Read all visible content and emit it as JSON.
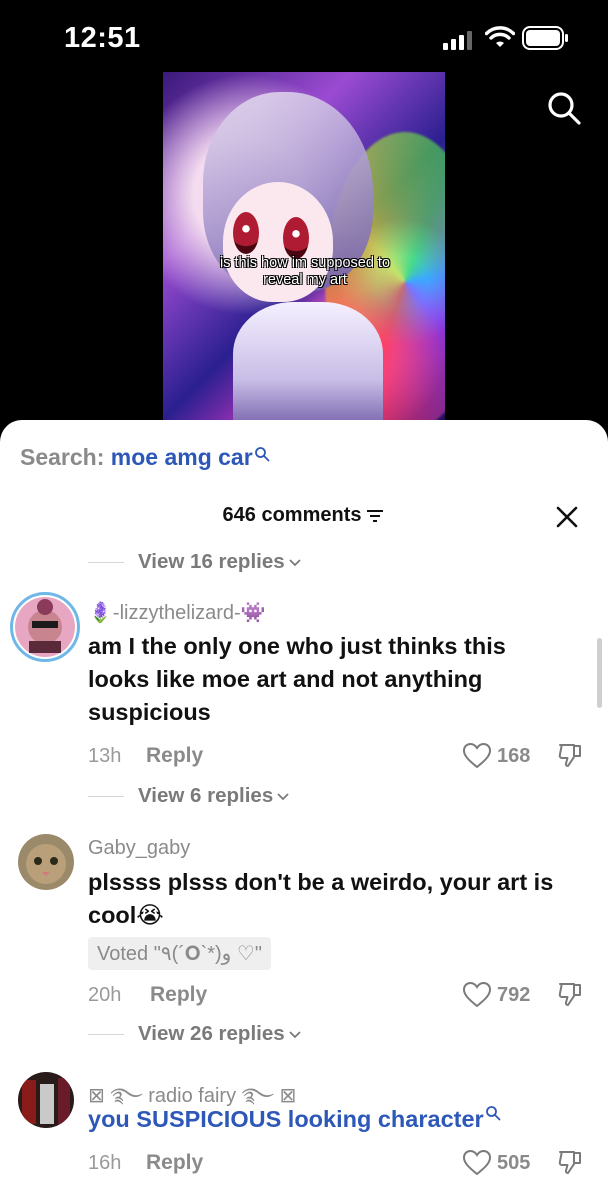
{
  "status_bar": {
    "time": "12:51"
  },
  "video": {
    "caption": "is this how im supposed to reveal my art"
  },
  "sheet": {
    "search_prefix": "Search:",
    "search_term": "moe amg car",
    "comments_count_label": "646 comments",
    "threads": [
      {
        "view_replies": "View 16 replies"
      },
      {
        "username": "🪻-lizzythelizard-👾",
        "text": "am I the only one who just thinks this looks like moe art and not anything suspicious",
        "time": "13h",
        "reply_label": "Reply",
        "likes": "168",
        "view_replies": "View 6 replies"
      },
      {
        "username": "Gaby_gaby",
        "text": "plssss plsss don't be a weirdo, your art is cool😭",
        "vote_label": "Voted \"٩(´𝐎`*)و ♡\"",
        "time": "20h",
        "reply_label": "Reply",
        "likes": "792",
        "view_replies": "View 26 replies"
      },
      {
        "username": "⊠ ࿐ radio fairy ࿐ ⊠",
        "text": "you SUSPICIOUS looking character",
        "time": "16h",
        "reply_label": "Reply",
        "likes": "505"
      }
    ]
  },
  "colors": {
    "link_blue": "#2d58b8",
    "muted_gray": "#8a8a8a",
    "sheet_bg": "#ffffff",
    "screen_bg": "#000000"
  },
  "icons": [
    "signal-icon",
    "wifi-icon",
    "battery-icon",
    "search-icon",
    "filter-icon",
    "close-icon",
    "chevron-down-icon",
    "heart-icon",
    "dislike-icon"
  ]
}
